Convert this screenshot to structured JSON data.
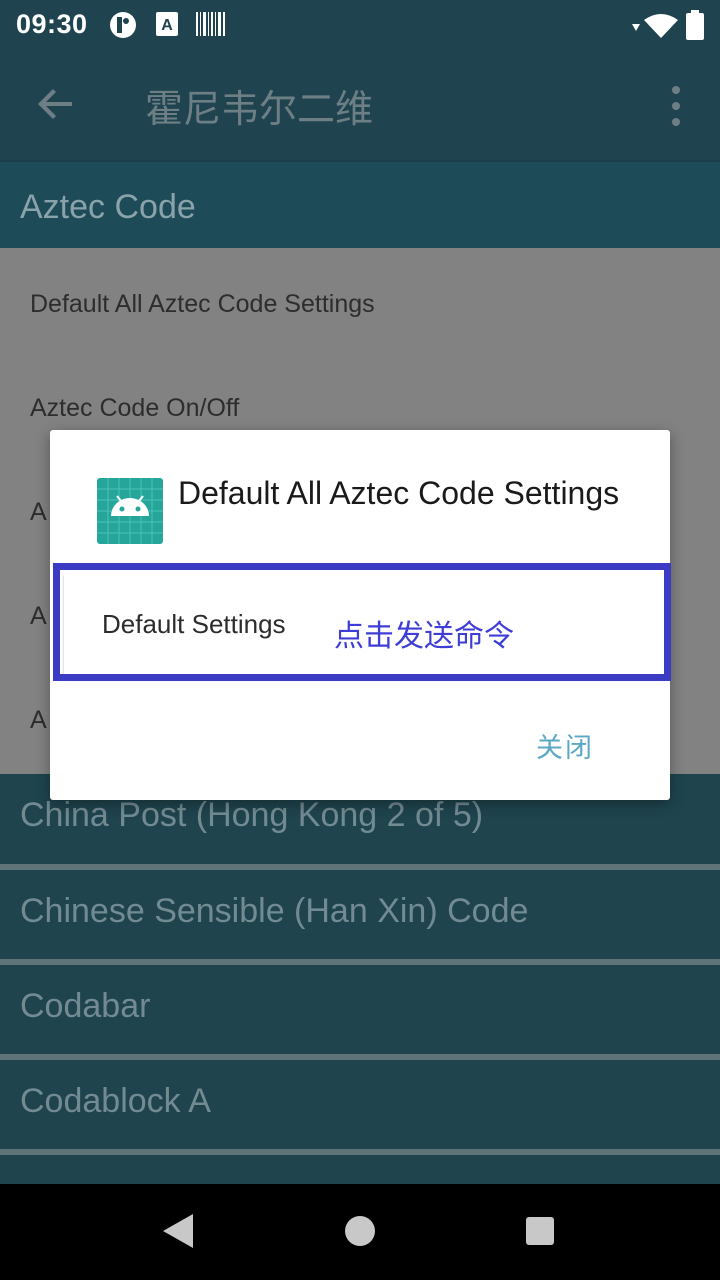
{
  "status_bar": {
    "time": "09:30",
    "icons": [
      "profile-icon",
      "a-notification-icon",
      "barcode-icon",
      "wifi-icon",
      "battery-icon"
    ]
  },
  "app_bar": {
    "title": "霍尼韦尔二维",
    "back_icon": "arrow-back-icon",
    "menu_icon": "more-vert-icon"
  },
  "section": {
    "title": "Aztec Code",
    "items": [
      "Default All Aztec Code Settings",
      "Aztec Code On/Off",
      "A",
      "A",
      "A"
    ]
  },
  "symbology_list": [
    "China Post (Hong Kong 2 of 5)",
    "Chinese Sensible (Han Xin) Code",
    "Codabar",
    "Codablock A"
  ],
  "dialog": {
    "title": "Default All Aztec Code Settings",
    "icon": "android-app-icon",
    "option_label": "Default Settings",
    "option_hint": "点击发送命令",
    "close_label": "关闭",
    "highlight_color": "#3b3bc4"
  },
  "colors": {
    "app_bar": "#1f444f",
    "accent": "#5aa8c4"
  }
}
